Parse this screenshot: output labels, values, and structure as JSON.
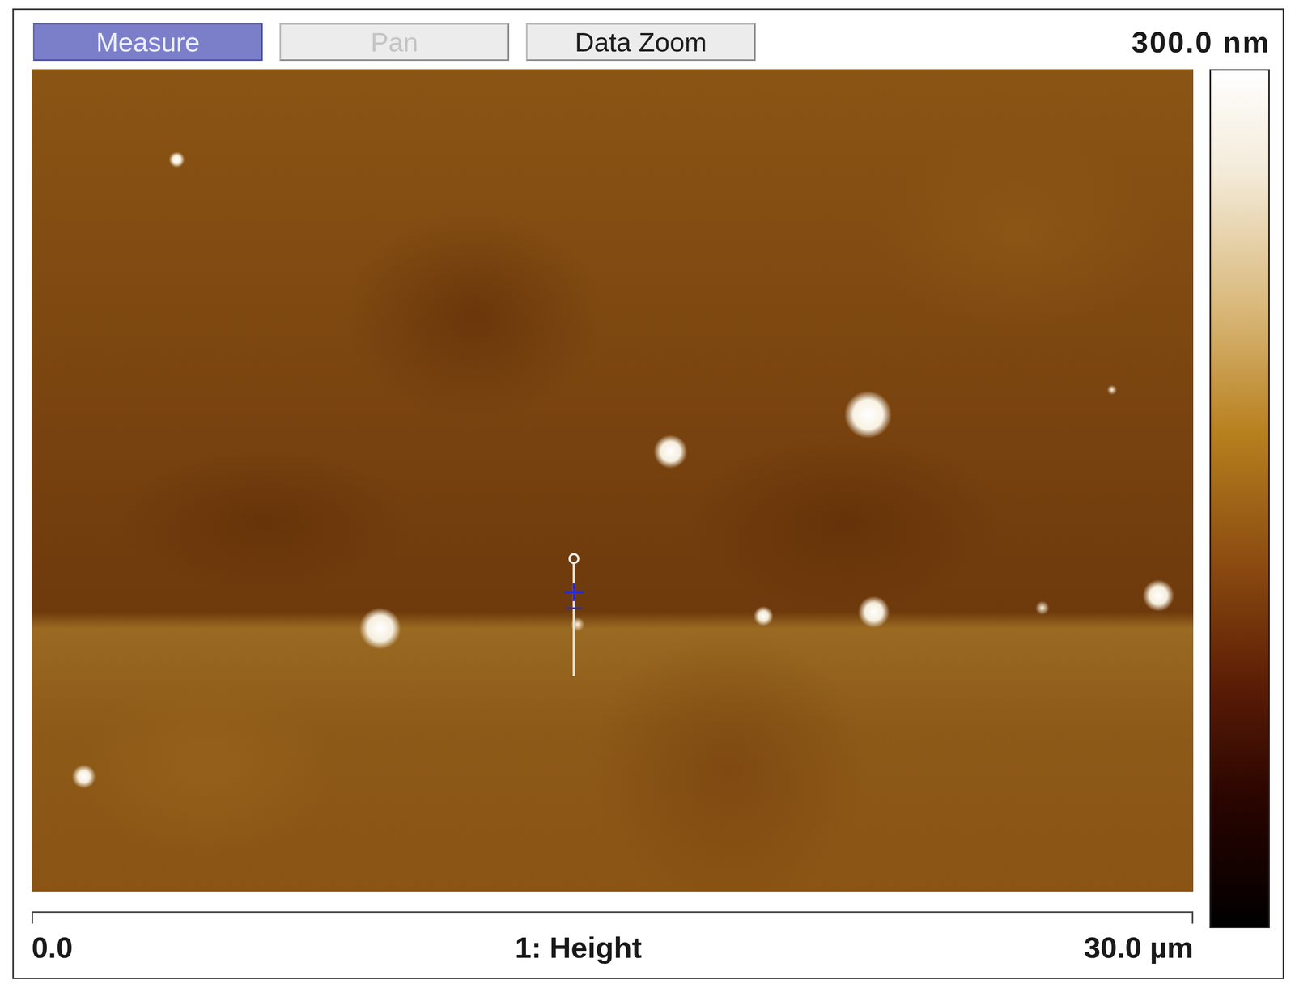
{
  "toolbar": {
    "buttons": [
      {
        "label": "Measure",
        "selected": true,
        "disabled": false
      },
      {
        "label": "Pan",
        "selected": false,
        "disabled": true
      },
      {
        "label": "Data Zoom",
        "selected": false,
        "disabled": false
      }
    ]
  },
  "color_scale": {
    "max": "300.0 nm"
  },
  "image": {
    "channel": "1: Height",
    "x_start": "0.0",
    "x_end": "30.0 µm"
  }
}
